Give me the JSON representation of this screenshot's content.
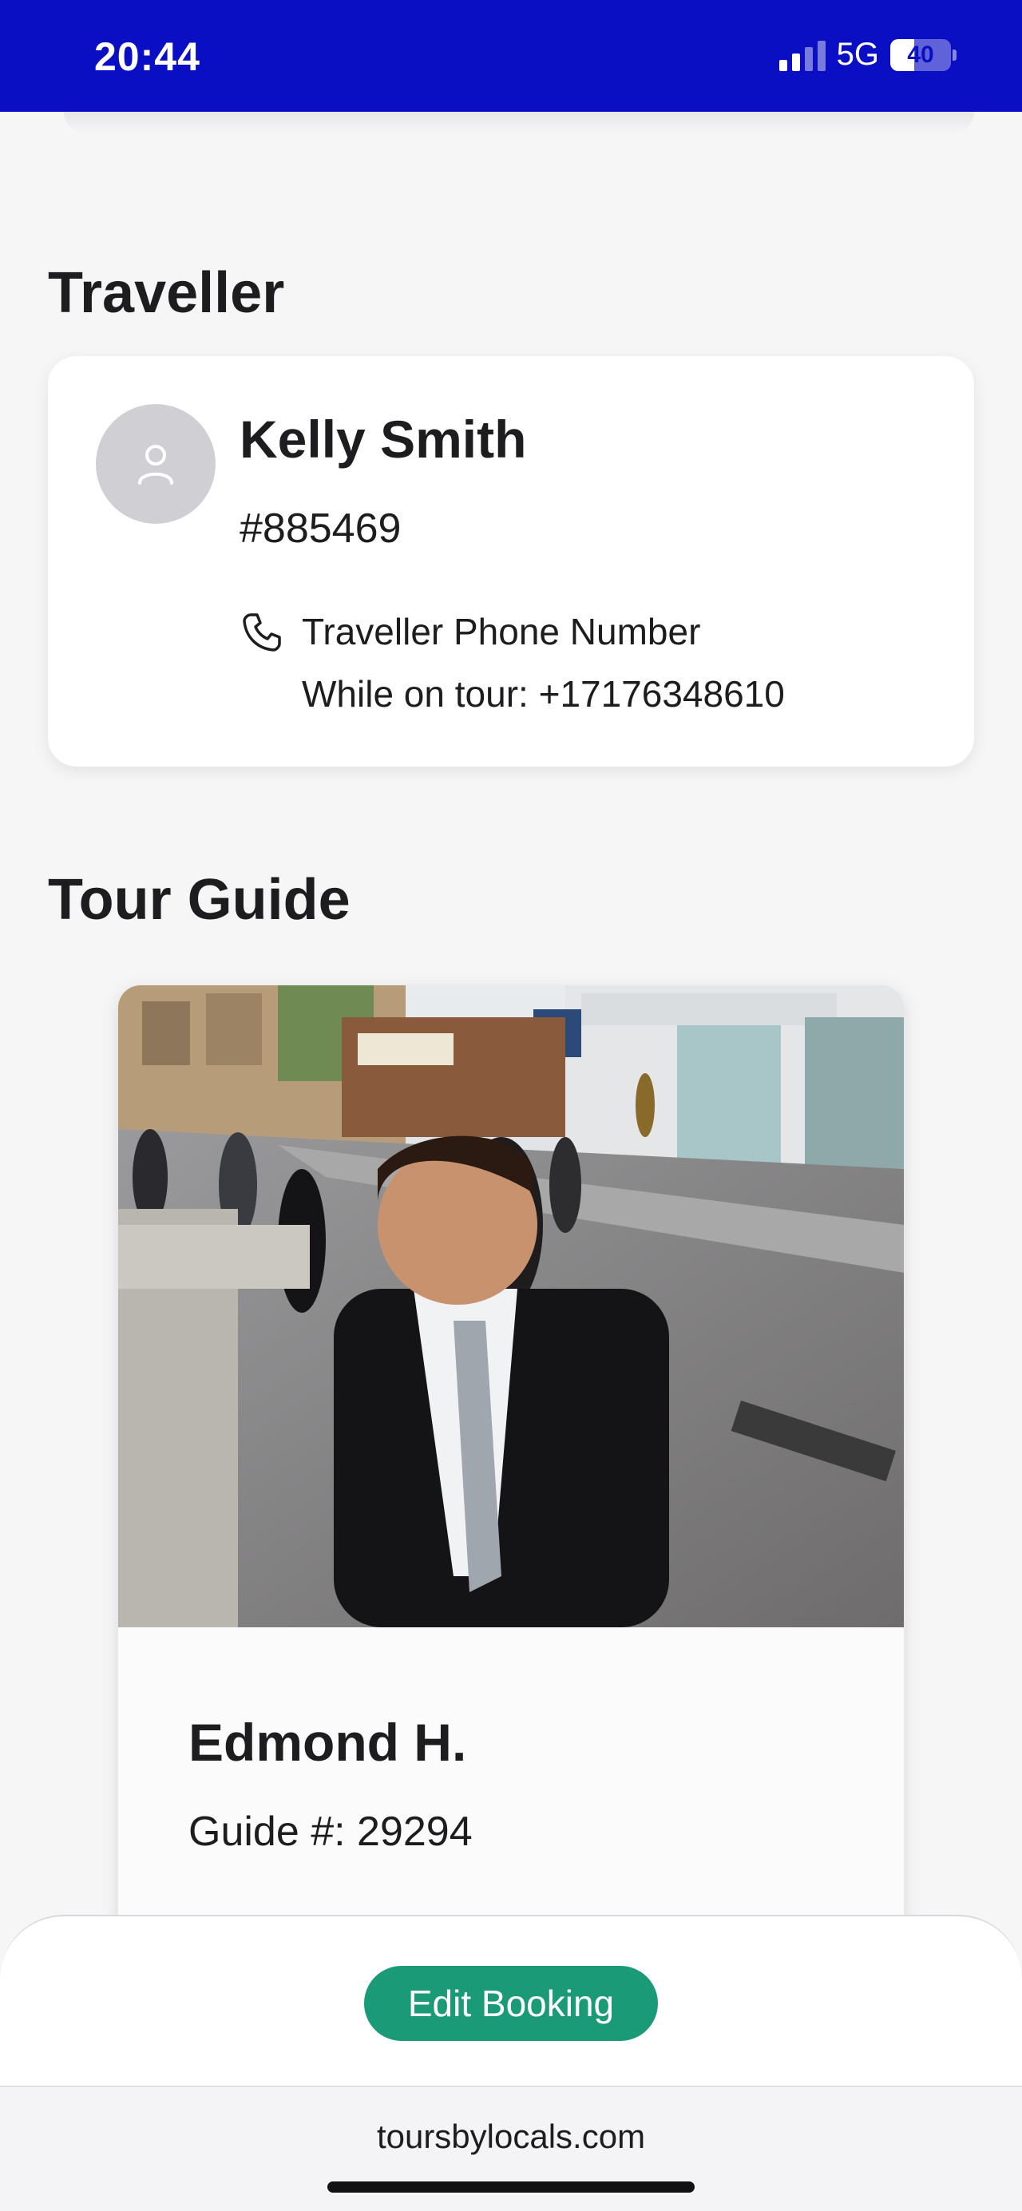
{
  "status_bar": {
    "time": "20:44",
    "network": "5G",
    "battery": "40",
    "battery_level": 0.4,
    "background_color": "#0a0fc4"
  },
  "traveller": {
    "section_title": "Traveller",
    "name": "Kelly Smith",
    "id": "#885469",
    "phone_label": "Traveller Phone Number",
    "phone_value": "While on tour: +17176348610",
    "icons": {
      "avatar": "user-icon",
      "phone": "phone-icon"
    }
  },
  "guide": {
    "section_title": "Tour Guide",
    "name": "Edmond H.",
    "number": "Guide #: 29294"
  },
  "actions": {
    "edit_booking": "Edit Booking",
    "accent_color": "#1b9a77"
  },
  "browser": {
    "url": "toursbylocals.com"
  }
}
